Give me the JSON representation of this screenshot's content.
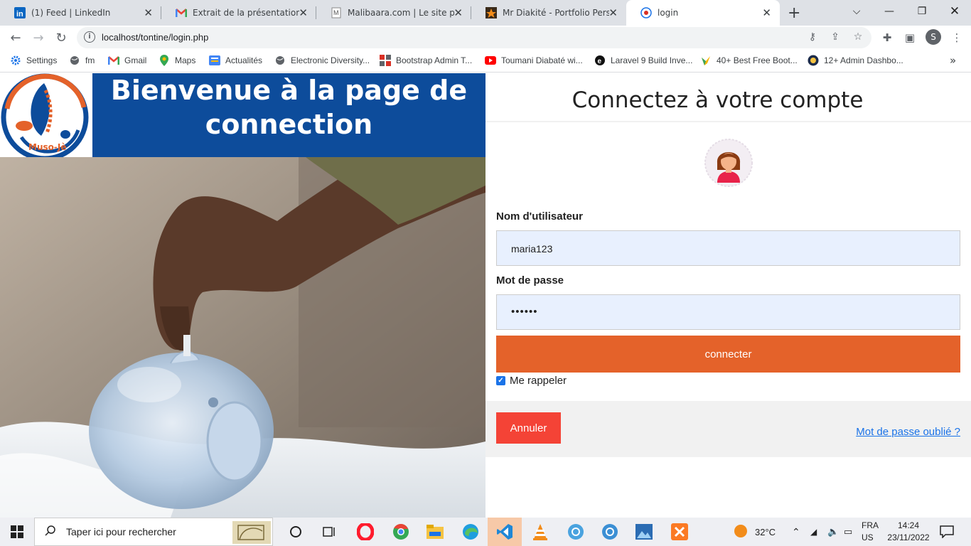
{
  "browser": {
    "tabs": [
      {
        "title": "(1) Feed | LinkedIn",
        "favicon": "linkedin-icon"
      },
      {
        "title": "Extrait de la présentation dét",
        "favicon": "gmail-icon"
      },
      {
        "title": "Malibaara.com | Le site par ex",
        "favicon": "malibaara-icon"
      },
      {
        "title": "Mr Diakité - Portfolio Personn",
        "favicon": "star-icon"
      },
      {
        "title": "login",
        "favicon": "globe-icon",
        "active": true
      }
    ],
    "url": "localhost/tontine/login.php",
    "profile_initial": "S",
    "bookmarks": [
      {
        "label": "Settings",
        "icon": "gear-icon"
      },
      {
        "label": "fm",
        "icon": "globe-icon"
      },
      {
        "label": "Gmail",
        "icon": "gmail-icon"
      },
      {
        "label": "Maps",
        "icon": "maps-icon"
      },
      {
        "label": "Actualités",
        "icon": "news-icon"
      },
      {
        "label": "Electronic Diversity...",
        "icon": "globe-icon"
      },
      {
        "label": "Bootstrap Admin T...",
        "icon": "bootstrap-icon"
      },
      {
        "label": "Toumani Diabaté wi...",
        "icon": "youtube-icon"
      },
      {
        "label": "Laravel 9 Build Inve...",
        "icon": "laravel-icon"
      },
      {
        "label": "40+ Best Free Boot...",
        "icon": "bird-icon"
      },
      {
        "label": "12+ Admin Dashbo...",
        "icon": "badge-icon"
      }
    ]
  },
  "page": {
    "banner_title": "Bienvenue à la page de connection",
    "logo_text": "Muso-Jè",
    "form": {
      "heading": "Connectez à votre compte",
      "username_label": "Nom d'utilisateur",
      "username_value": "maria123",
      "password_label": "Mot de passe",
      "password_value": "••••••",
      "submit_label": "connecter",
      "remember_label": "Me rappeler",
      "remember_checked": true,
      "cancel_label": "Annuler",
      "forgot_label": "Mot de passe oublié ?"
    },
    "colors": {
      "banner": "#0d4c9b",
      "submit": "#e4622a",
      "cancel": "#f44336",
      "link": "#1a73e8"
    }
  },
  "taskbar": {
    "search_placeholder": "Taper ici pour rechercher",
    "temperature": "32°C",
    "lang_line1": "FRA",
    "lang_line2": "US",
    "time": "14:24",
    "date": "23/11/2022"
  }
}
